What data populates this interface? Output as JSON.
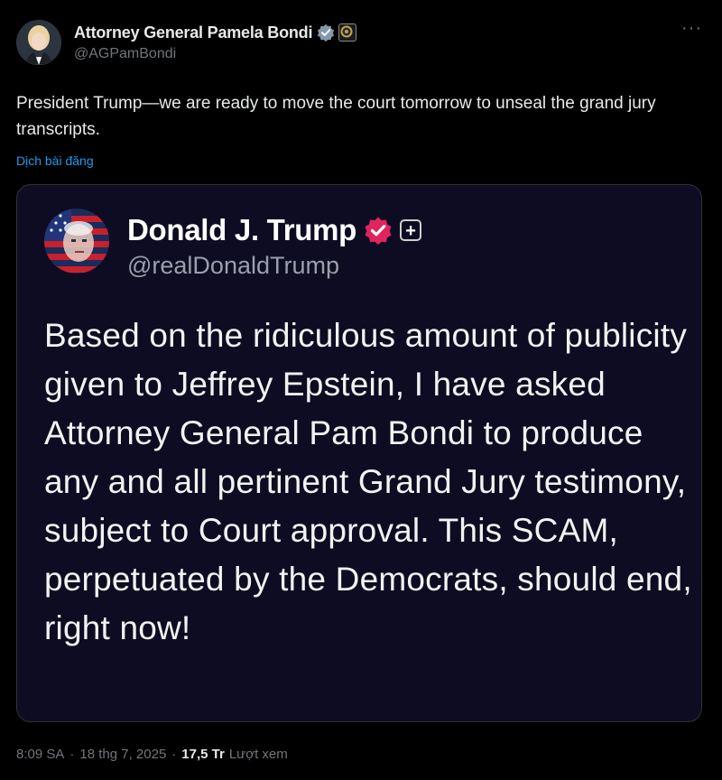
{
  "author": {
    "display_name": "Attorney General Pamela Bondi",
    "handle": "@AGPamBondi",
    "avatar_icon": "profile-photo",
    "verified_icon": "gray-verified-badge-icon",
    "affiliate_icon": "government-seal-icon"
  },
  "more_label": "···",
  "tweet": {
    "text": "President Trump—we are ready to move the court tomorrow to unseal the grand jury transcripts.",
    "translate_label": "Dịch bài đăng"
  },
  "quote": {
    "display_name": "Donald J. Trump",
    "handle": "@realDonaldTrump",
    "verified_icon": "pink-verified-badge-icon",
    "plus_label": "+",
    "text": "Based on the ridiculous amount of publicity given to Jeffrey Epstein, I have asked Attorney General Pam Bondi to produce any and all pertinent Grand Jury testimony, subject to Court approval. This SCAM, perpetuated by the Democrats, should end, right now!"
  },
  "meta": {
    "time": "8:09 SA",
    "sep": "·",
    "date": "18 thg 7, 2025",
    "views_count": "17,5 Tr",
    "views_label": "Lượt xem"
  },
  "colors": {
    "background": "#000000",
    "text": "#e7e9ea",
    "secondary": "#71767b",
    "link": "#1d9bf0",
    "quote_background": "#0e0c22",
    "quote_badge": "#e0245e"
  }
}
